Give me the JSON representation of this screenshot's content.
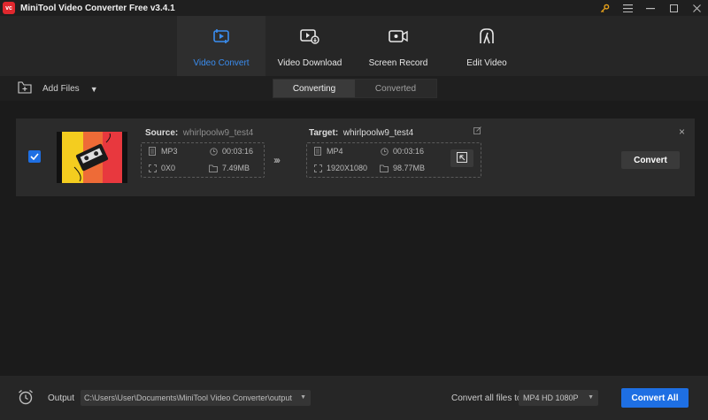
{
  "window": {
    "logo_text": "vc",
    "title": "MiniTool Video Converter Free v3.4.1",
    "controls": [
      "key-icon",
      "menu-icon",
      "minimize-icon",
      "maximize-icon",
      "close-icon"
    ]
  },
  "nav": {
    "tabs": [
      {
        "label": "Video Convert",
        "icon": "video-convert-icon",
        "active": true
      },
      {
        "label": "Video Download",
        "icon": "video-download-icon",
        "active": false
      },
      {
        "label": "Screen Record",
        "icon": "screen-record-icon",
        "active": false
      },
      {
        "label": "Edit Video",
        "icon": "edit-video-icon",
        "active": false
      }
    ]
  },
  "toolbar": {
    "add_files_label": "Add Files",
    "tabs": [
      {
        "label": "Converting",
        "active": true
      },
      {
        "label": "Converted",
        "active": false
      }
    ]
  },
  "task": {
    "checked": true,
    "source": {
      "label": "Source:",
      "name": "whirlpoolw9_test4",
      "format": "MP3",
      "duration": "00:03:16",
      "resolution": "0X0",
      "size": "7.49MB"
    },
    "target": {
      "label": "Target:",
      "name": "whirlpoolw9_test4",
      "format": "MP4",
      "duration": "00:03:16",
      "resolution": "1920X1080",
      "size": "98.77MB"
    },
    "arrows": "›››",
    "convert_label": "Convert",
    "close_symbol": "×"
  },
  "bottom": {
    "output_label": "Output",
    "output_path": "C:\\Users\\User\\Documents\\MiniTool Video Converter\\output",
    "convert_all_files_to_label": "Convert all files to",
    "format_value": "MP4 HD 1080P",
    "convert_all_label": "Convert All"
  },
  "colors": {
    "accent": "#1e6fe3",
    "active_tab_text": "#3a8df0",
    "logo_red": "#e0282e",
    "key_icon": "#e8a21a"
  }
}
